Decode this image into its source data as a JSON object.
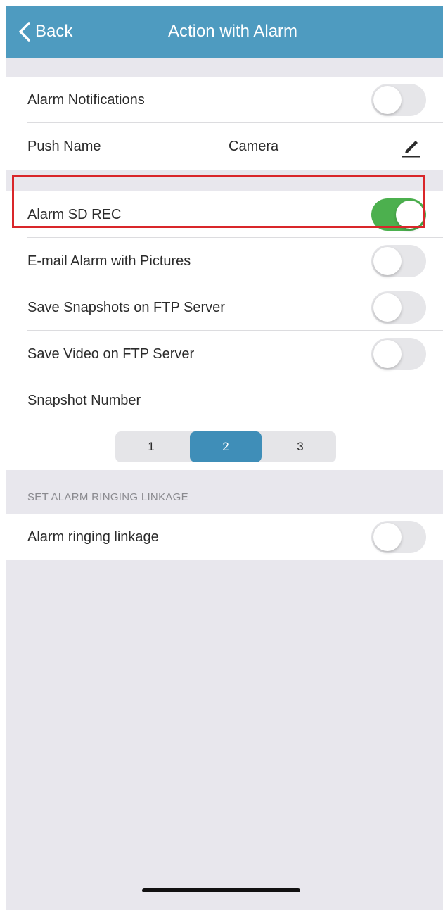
{
  "colors": {
    "nav_bar": "#4e9bc0",
    "toggle_on": "#4cb04e",
    "toggle_off": "#e6e6e9",
    "segment_active": "#3f8eb8",
    "highlight_border": "#d9262a"
  },
  "navbar": {
    "back_icon": "chevron-left-icon",
    "back_label": "Back",
    "title": "Action with Alarm"
  },
  "notifications": {
    "alarm_notifications": {
      "label": "Alarm Notifications",
      "on": false
    },
    "push_name": {
      "label": "Push Name",
      "value": "Camera",
      "edit_icon": "pencil-icon"
    }
  },
  "recording": {
    "alarm_sd_rec": {
      "label": "Alarm SD REC",
      "on": true
    },
    "email_alarm": {
      "label": "E-mail Alarm with Pictures",
      "on": false
    },
    "ftp_snapshots": {
      "label": "Save Snapshots on FTP Server",
      "on": false
    },
    "ftp_video": {
      "label": "Save Video on FTP Server",
      "on": false
    },
    "snapshot_number": {
      "label": "Snapshot Number",
      "options": [
        "1",
        "2",
        "3"
      ],
      "selected": "2"
    }
  },
  "ringing": {
    "section_header": "SET ALARM RINGING LINKAGE",
    "alarm_ringing_linkage": {
      "label": "Alarm ringing linkage",
      "on": false
    }
  }
}
